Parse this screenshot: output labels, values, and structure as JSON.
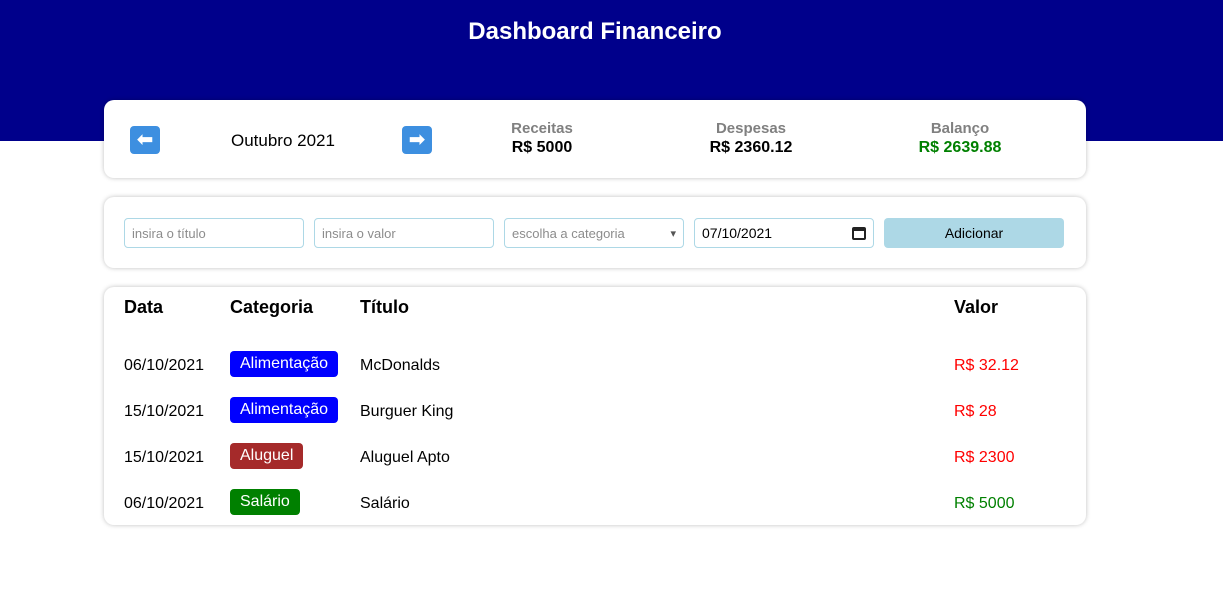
{
  "header": {
    "title": "Dashboard Financeiro",
    "background": "#00008b"
  },
  "info": {
    "prev_icon": "arrow-left-icon",
    "next_icon": "arrow-right-icon",
    "prev_glyph": "⬅",
    "next_glyph": "➡",
    "month": "Outubro 2021",
    "receitas": {
      "title": "Receitas",
      "value": "R$ 5000"
    },
    "despesas": {
      "title": "Despesas",
      "value": "R$ 2360.12"
    },
    "balanco": {
      "title": "Balanço",
      "value": "R$ 2639.88",
      "color": "#008000"
    }
  },
  "form": {
    "title_placeholder": "insira o título",
    "value_placeholder": "insira o valor",
    "category_placeholder": "escolha a categoria",
    "date_value": "07/10/2021",
    "add_label": "Adicionar"
  },
  "table": {
    "headers": {
      "data": "Data",
      "categoria": "Categoria",
      "titulo": "Título",
      "valor": "Valor"
    },
    "rows": [
      {
        "data": "06/10/2021",
        "categoria": "Alimentação",
        "cat_color": "#0000ff",
        "titulo": "McDonalds",
        "valor": "R$ 32.12",
        "val_color": "#ff0000"
      },
      {
        "data": "15/10/2021",
        "categoria": "Alimentação",
        "cat_color": "#0000ff",
        "titulo": "Burguer King",
        "valor": "R$ 28",
        "val_color": "#ff0000"
      },
      {
        "data": "15/10/2021",
        "categoria": "Aluguel",
        "cat_color": "#a52a2a",
        "titulo": "Aluguel Apto",
        "valor": "R$ 2300",
        "val_color": "#ff0000"
      },
      {
        "data": "06/10/2021",
        "categoria": "Salário",
        "cat_color": "#008000",
        "titulo": "Salário",
        "valor": "R$ 5000",
        "val_color": "#008000"
      }
    ]
  }
}
